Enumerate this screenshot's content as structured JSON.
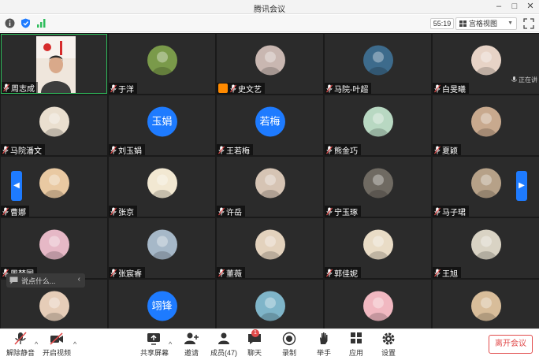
{
  "window": {
    "title": "腾讯会议"
  },
  "infobar": {
    "timer": "55:19",
    "view_mode": "宫格视图"
  },
  "grid": {
    "tiles": [
      {
        "name": "周志成",
        "avatar": "video",
        "color": ""
      },
      {
        "name": "于洋",
        "avatar": "photo",
        "color": "#7a9a4a"
      },
      {
        "name": "史文艺",
        "avatar": "photo",
        "color": "#c9b7b1",
        "host": true
      },
      {
        "name": "马院-叶超",
        "avatar": "photo",
        "color": "#3d6b8c"
      },
      {
        "name": "白旻曦",
        "avatar": "photo",
        "color": "#e7d3c6",
        "speaking": "正在讲"
      },
      {
        "name": "马院潘文",
        "avatar": "photo",
        "color": "#eadfcf"
      },
      {
        "name": "刘玉娟",
        "avatar": "text",
        "initials": "玉娟"
      },
      {
        "name": "王若梅",
        "avatar": "text",
        "initials": "若梅"
      },
      {
        "name": "熊金巧",
        "avatar": "photo",
        "color": "#b8d8c2"
      },
      {
        "name": "夏颖",
        "avatar": "photo",
        "color": "#c8a98e"
      },
      {
        "name": "曹娜",
        "avatar": "photo",
        "color": "#e9c9a2"
      },
      {
        "name": "张京",
        "avatar": "photo",
        "color": "#f2e8d2"
      },
      {
        "name": "许岳",
        "avatar": "photo",
        "color": "#d6c4b4"
      },
      {
        "name": "宁玉琢",
        "avatar": "photo",
        "color": "#6f6a62"
      },
      {
        "name": "马子珺",
        "avatar": "photo",
        "color": "#b6a188"
      },
      {
        "name": "周梦圆",
        "avatar": "photo",
        "color": "#e6b8c6"
      },
      {
        "name": "张宸睿",
        "avatar": "photo",
        "color": "#a6b8c8"
      },
      {
        "name": "董薇",
        "avatar": "photo",
        "color": "#e3d2bd"
      },
      {
        "name": "郭佳妮",
        "avatar": "photo",
        "color": "#e9dcc6"
      },
      {
        "name": "王旭",
        "avatar": "photo",
        "color": "#d9d3c4"
      },
      {
        "name": "",
        "avatar": "photo",
        "color": "#e6cdb8"
      },
      {
        "name": "",
        "avatar": "text",
        "initials": "翊锋"
      },
      {
        "name": "",
        "avatar": "photo",
        "color": "#7fb5c9"
      },
      {
        "name": "",
        "avatar": "photo",
        "color": "#f1b8c1"
      },
      {
        "name": "",
        "avatar": "photo",
        "color": "#d8bd9a"
      }
    ],
    "chat_placeholder": "说点什么..."
  },
  "toolbar": {
    "unmute": "解除静音",
    "start_video": "开启视频",
    "share_screen": "共享屏幕",
    "invite": "邀请",
    "members": "成员(47)",
    "chat": "聊天",
    "chat_badge": "1",
    "record": "录制",
    "raise_hand": "举手",
    "apps": "应用",
    "settings": "设置",
    "leave": "离开会议"
  },
  "colors": {
    "accent": "#1e7bff",
    "active_border": "#2fbd5c",
    "danger": "#e14b4b",
    "host": "#ff8a00"
  }
}
